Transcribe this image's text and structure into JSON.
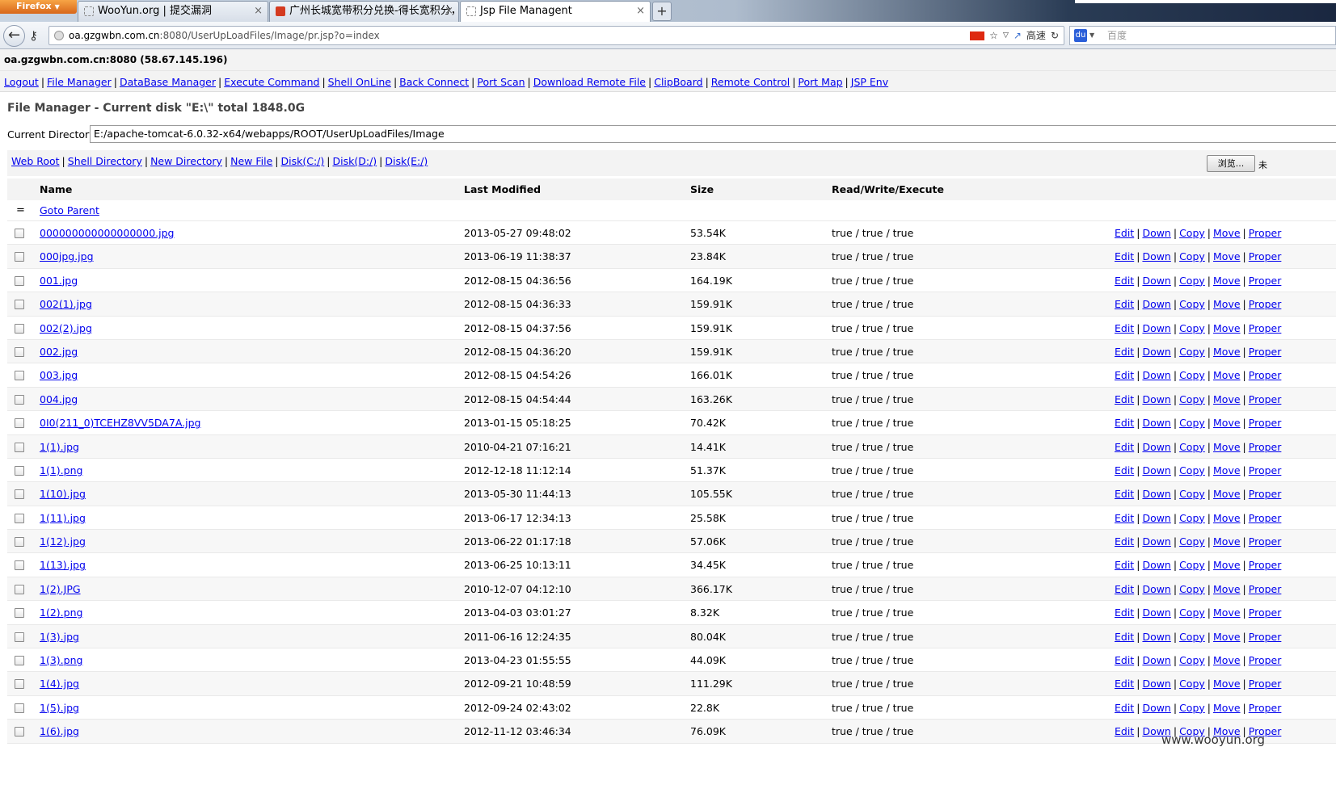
{
  "browser": {
    "app_button": "Firefox",
    "tabs": [
      {
        "title": "WooYun.org | 提交漏洞",
        "active": false
      },
      {
        "title": "广州长城宽带积分兑换-得长宽积分，...",
        "active": false
      },
      {
        "title": "Jsp File Managent",
        "active": true
      }
    ],
    "url_host": "oa.gzgwbn.com.cn",
    "url_rest": ":8080/UserUpLoadFiles/Image/pr.jsp?o=index",
    "speed_label": "高速",
    "search_placeholder": "百度"
  },
  "page": {
    "host_line": "oa.gzgwbn.com.cn:8080 (58.67.145.196)",
    "top_nav": [
      "Logout",
      "File Manager",
      "DataBase Manager",
      "Execute Command",
      "Shell OnLine",
      "Back Connect",
      "Port Scan",
      "Download Remote File",
      "ClipBoard",
      "Remote Control",
      "Port Map",
      "JSP Env"
    ],
    "title": "File Manager - Current disk \"E:\\\" total 1848.0G",
    "current_dir_label": "Current Directory",
    "current_dir_value": "E:/apache-tomcat-6.0.32-x64/webapps/ROOT/UserUpLoadFiles/Image",
    "toolbar_links": [
      "Web Root",
      "Shell Directory",
      "New Directory",
      "New File",
      "Disk(C:/)",
      "Disk(D:/)",
      "Disk(E:/)"
    ],
    "browse_button": "浏览...",
    "browse_extra": "未",
    "columns": {
      "name": "Name",
      "modified": "Last Modified",
      "size": "Size",
      "rwx": "Read/Write/Execute"
    },
    "parent_icon": "=",
    "parent_link": "Goto Parent",
    "actions": [
      "Edit",
      "Down",
      "Copy",
      "Move",
      "Proper"
    ],
    "files": [
      {
        "name": "000000000000000000.jpg",
        "modified": "2013-05-27 09:48:02",
        "size": "53.54K",
        "rwx": "true / true / true"
      },
      {
        "name": "000jpg.jpg",
        "modified": "2013-06-19 11:38:37",
        "size": "23.84K",
        "rwx": "true / true / true"
      },
      {
        "name": "001.jpg",
        "modified": "2012-08-15 04:36:56",
        "size": "164.19K",
        "rwx": "true / true / true"
      },
      {
        "name": "002(1).jpg",
        "modified": "2012-08-15 04:36:33",
        "size": "159.91K",
        "rwx": "true / true / true"
      },
      {
        "name": "002(2).jpg",
        "modified": "2012-08-15 04:37:56",
        "size": "159.91K",
        "rwx": "true / true / true"
      },
      {
        "name": "002.jpg",
        "modified": "2012-08-15 04:36:20",
        "size": "159.91K",
        "rwx": "true / true / true"
      },
      {
        "name": "003.jpg",
        "modified": "2012-08-15 04:54:26",
        "size": "166.01K",
        "rwx": "true / true / true"
      },
      {
        "name": "004.jpg",
        "modified": "2012-08-15 04:54:44",
        "size": "163.26K",
        "rwx": "true / true / true"
      },
      {
        "name": "0I0(211_0)TCEHZ8VV5DA7A.jpg",
        "modified": "2013-01-15 05:18:25",
        "size": "70.42K",
        "rwx": "true / true / true"
      },
      {
        "name": "1(1).jpg",
        "modified": "2010-04-21 07:16:21",
        "size": "14.41K",
        "rwx": "true / true / true"
      },
      {
        "name": "1(1).png",
        "modified": "2012-12-18 11:12:14",
        "size": "51.37K",
        "rwx": "true / true / true"
      },
      {
        "name": "1(10).jpg",
        "modified": "2013-05-30 11:44:13",
        "size": "105.55K",
        "rwx": "true / true / true"
      },
      {
        "name": "1(11).jpg",
        "modified": "2013-06-17 12:34:13",
        "size": "25.58K",
        "rwx": "true / true / true"
      },
      {
        "name": "1(12).jpg",
        "modified": "2013-06-22 01:17:18",
        "size": "57.06K",
        "rwx": "true / true / true"
      },
      {
        "name": "1(13).jpg",
        "modified": "2013-06-25 10:13:11",
        "size": "34.45K",
        "rwx": "true / true / true"
      },
      {
        "name": "1(2).JPG",
        "modified": "2010-12-07 04:12:10",
        "size": "366.17K",
        "rwx": "true / true / true"
      },
      {
        "name": "1(2).png",
        "modified": "2013-04-03 03:01:27",
        "size": "8.32K",
        "rwx": "true / true / true"
      },
      {
        "name": "1(3).jpg",
        "modified": "2011-06-16 12:24:35",
        "size": "80.04K",
        "rwx": "true / true / true"
      },
      {
        "name": "1(3).png",
        "modified": "2013-04-23 01:55:55",
        "size": "44.09K",
        "rwx": "true / true / true"
      },
      {
        "name": "1(4).jpg",
        "modified": "2012-09-21 10:48:59",
        "size": "111.29K",
        "rwx": "true / true / true"
      },
      {
        "name": "1(5).jpg",
        "modified": "2012-09-24 02:43:02",
        "size": "22.8K",
        "rwx": "true / true / true"
      },
      {
        "name": "1(6).jpg",
        "modified": "2012-11-12 03:46:34",
        "size": "76.09K",
        "rwx": "true / true / true"
      }
    ],
    "watermark": "www.wooyun.org"
  }
}
